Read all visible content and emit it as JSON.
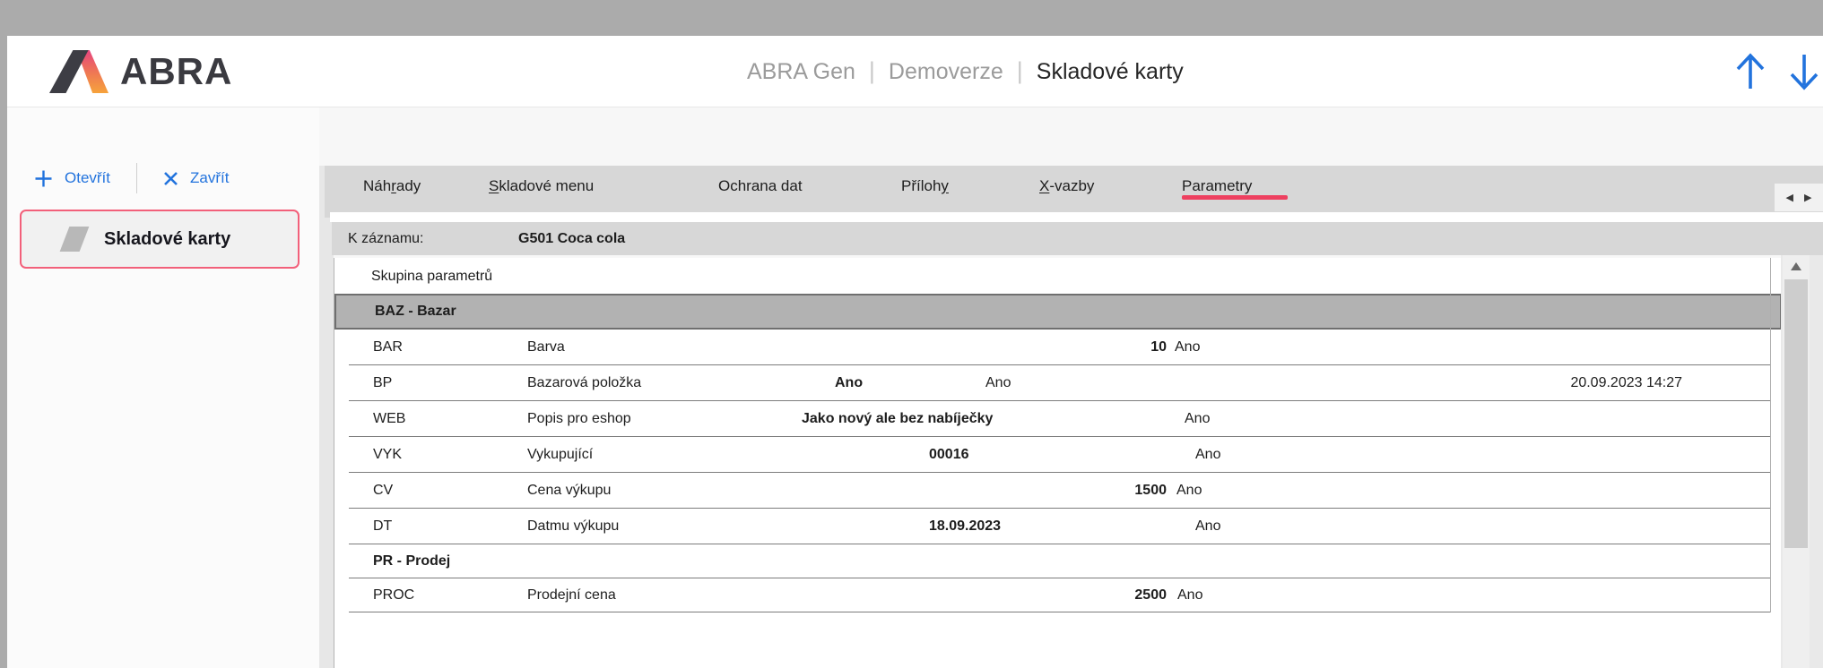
{
  "colors": {
    "accent_blue": "#2273DD",
    "tab_underline_red": "#EE4060",
    "sidebar_item_border_red": "#F2607A",
    "selected_row_gray": "#B2B2B2",
    "logo_pink": "#E6447E",
    "logo_orange": "#F6A33C"
  },
  "header": {
    "logo_text": "ABRA",
    "breadcrumb": {
      "app": "ABRA Gen",
      "env": "Demoverze",
      "page": "Skladové karty",
      "separator": "|"
    },
    "up_icon": "arrow-up",
    "down_icon": "arrow-down"
  },
  "sidebar": {
    "open_label": "Otevřít",
    "close_label": "Zavřít",
    "item_label": "Skladové karty"
  },
  "tabs": [
    {
      "id": "nahrady",
      "pre": "Náh",
      "key": "r",
      "post": "ady"
    },
    {
      "id": "skladove-menu",
      "pre": "",
      "key": "S",
      "post": "kladové menu"
    },
    {
      "id": "ochrana-dat",
      "pre": "Ochrana dat",
      "key": "",
      "post": ""
    },
    {
      "id": "prilohy",
      "pre": "Příloh",
      "key": "y",
      "post": ""
    },
    {
      "id": "x-vazby",
      "pre": "",
      "key": "X",
      "post": "-vazby"
    },
    {
      "id": "parametry",
      "pre": "Parametry",
      "key": "",
      "post": "",
      "active": true
    }
  ],
  "tab_scroller": {
    "left": "◀",
    "right": "▶"
  },
  "record_bar": {
    "label": "K záznamu:",
    "value": "G501 Coca cola"
  },
  "table": {
    "header": "Skupina parametrů",
    "rows": [
      {
        "type": "group",
        "label": "BAZ - Bazar",
        "selected": true
      },
      {
        "type": "param",
        "code": "BAR",
        "name": "Barva",
        "value": "10",
        "flag": "Ano"
      },
      {
        "type": "param",
        "code": "BP",
        "name": "Bazarová položka",
        "value": "Ano",
        "flag": "Ano",
        "changed": "20.09.2023 14:27"
      },
      {
        "type": "param",
        "code": "WEB",
        "name": "Popis pro eshop",
        "value": "Jako nový ale bez nabíječky",
        "flag": "Ano"
      },
      {
        "type": "param",
        "code": "VYK",
        "name": "Vykupující",
        "value": "00016",
        "flag": "Ano"
      },
      {
        "type": "param",
        "code": "CV",
        "name": "Cena výkupu",
        "value": "1500",
        "flag": "Ano"
      },
      {
        "type": "param",
        "code": "DT",
        "name": "Datmu výkupu",
        "value": "18.09.2023",
        "flag": "Ano"
      },
      {
        "type": "group",
        "label": "PR - Prodej"
      },
      {
        "type": "param",
        "code": "PROC",
        "name": "Prodejní cena",
        "value": "2500",
        "flag": "Ano"
      }
    ]
  }
}
